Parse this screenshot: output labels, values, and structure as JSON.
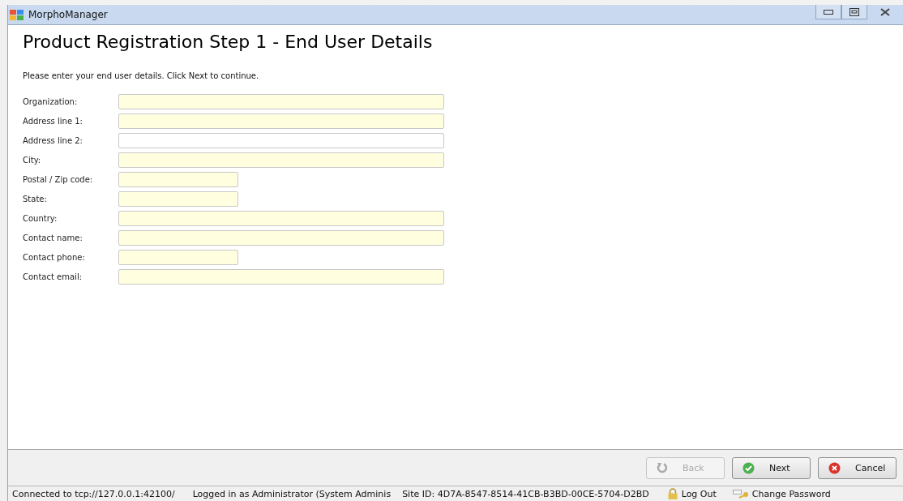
{
  "window": {
    "title": "MorphoManager"
  },
  "page": {
    "heading": "Product Registration Step 1 - End User Details",
    "instructions": "Please enter your end user details. Click Next to continue."
  },
  "fields": [
    {
      "label": "Organization:",
      "kind": "wide",
      "required": true
    },
    {
      "label": "Address line 1:",
      "kind": "wide",
      "required": true
    },
    {
      "label": "Address line 2:",
      "kind": "wide",
      "required": false
    },
    {
      "label": "City:",
      "kind": "wide",
      "required": true
    },
    {
      "label": "Postal / Zip code:",
      "kind": "short",
      "required": true
    },
    {
      "label": "State:",
      "kind": "short",
      "required": true
    },
    {
      "label": "Country:",
      "kind": "wide",
      "required": true
    },
    {
      "label": "Contact name:",
      "kind": "wide",
      "required": true
    },
    {
      "label": "Contact phone:",
      "kind": "short",
      "required": true
    },
    {
      "label": "Contact email:",
      "kind": "wide",
      "required": true
    }
  ],
  "buttons": [
    {
      "kind": "back",
      "label": "Back",
      "disabled": true
    },
    {
      "kind": "next",
      "label": "Next",
      "disabled": false
    },
    {
      "kind": "cancel",
      "label": "Cancel",
      "disabled": false
    }
  ],
  "status_bar": {
    "connection": "Connected to tcp://127.0.0.1:42100/",
    "user": "Logged in as Administrator (System Adminis",
    "site_id": "Site ID: 4D7A-8547-8514-41CB-B3BD-00CE-5704-D2BD",
    "logout": "Log Out",
    "change_password": "Change Password"
  }
}
